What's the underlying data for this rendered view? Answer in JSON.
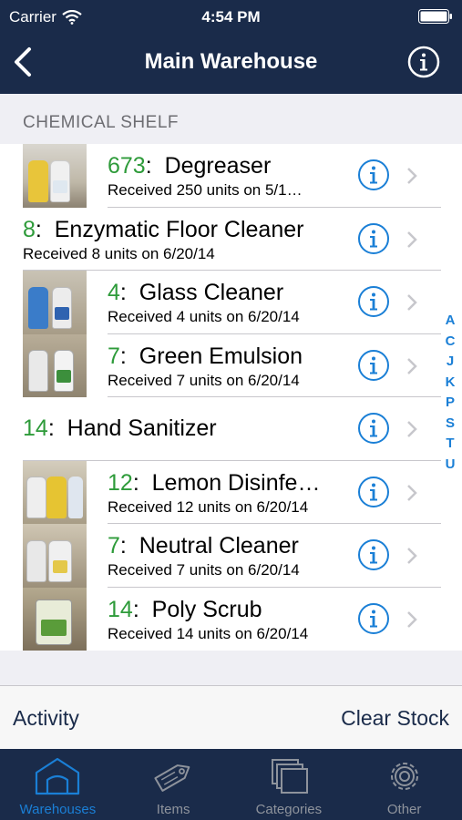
{
  "status": {
    "carrier": "Carrier",
    "time": "4:54 PM"
  },
  "nav": {
    "title": "Main Warehouse"
  },
  "section": {
    "header": "CHEMICAL SHELF"
  },
  "rows": [
    {
      "qty": "673",
      "name": "Degreaser",
      "detail": "Received 250 units on 5/1…"
    },
    {
      "qty": "8",
      "name": "Enzymatic Floor Cleaner",
      "detail": "Received 8 units on 6/20/14"
    },
    {
      "qty": "4",
      "name": "Glass Cleaner",
      "detail": "Received 4 units on 6/20/14"
    },
    {
      "qty": "7",
      "name": "Green Emulsion",
      "detail": "Received 7 units on 6/20/14"
    },
    {
      "qty": "14",
      "name": "Hand Sanitizer",
      "detail": ""
    },
    {
      "qty": "12",
      "name": "Lemon Disinfe…",
      "detail": "Received 12 units on 6/20/14"
    },
    {
      "qty": "7",
      "name": "Neutral Cleaner",
      "detail": "Received 7 units on 6/20/14"
    },
    {
      "qty": "14",
      "name": "Poly Scrub",
      "detail": "Received 14 units on 6/20/14"
    }
  ],
  "index_letters": [
    "A",
    "C",
    "J",
    "K",
    "P",
    "S",
    "T",
    "U"
  ],
  "toolbar": {
    "left": "Activity",
    "right": "Clear Stock"
  },
  "tabs": [
    {
      "label": "Warehouses",
      "icon": "warehouse-icon",
      "active": true
    },
    {
      "label": "Items",
      "icon": "tag-icon",
      "active": false
    },
    {
      "label": "Categories",
      "icon": "stacked-squares-icon",
      "active": false
    },
    {
      "label": "Other",
      "icon": "gear-icon",
      "active": false
    }
  ],
  "colors": {
    "nav_bg": "#1a2b4a",
    "accent": "#1a7fd6",
    "qty_green": "#2e9b3a"
  }
}
